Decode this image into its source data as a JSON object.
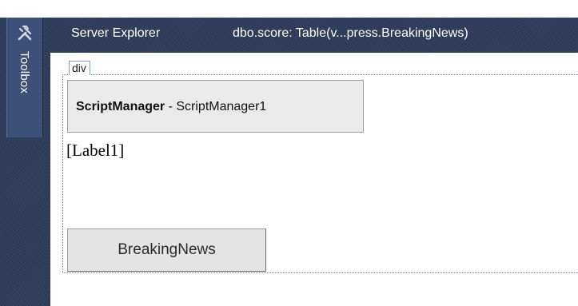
{
  "toolbox": {
    "label": "Toolbox",
    "icon": "toolbox-icon"
  },
  "tabs": [
    {
      "label": "Server Explorer"
    },
    {
      "label": "dbo.score: Table(v...press.BreakingNews)"
    }
  ],
  "designer": {
    "div_tag": "div",
    "script_manager": {
      "type": "ScriptManager",
      "separator": " - ",
      "id": "ScriptManager1"
    },
    "label": "[Label1]",
    "button_text": "BreakingNews"
  },
  "colors": {
    "chrome": "#2e3d5a",
    "toolbox_tab": "#3c5078",
    "design_surface": "#ffffff",
    "control_fill": "#eaeaea"
  }
}
